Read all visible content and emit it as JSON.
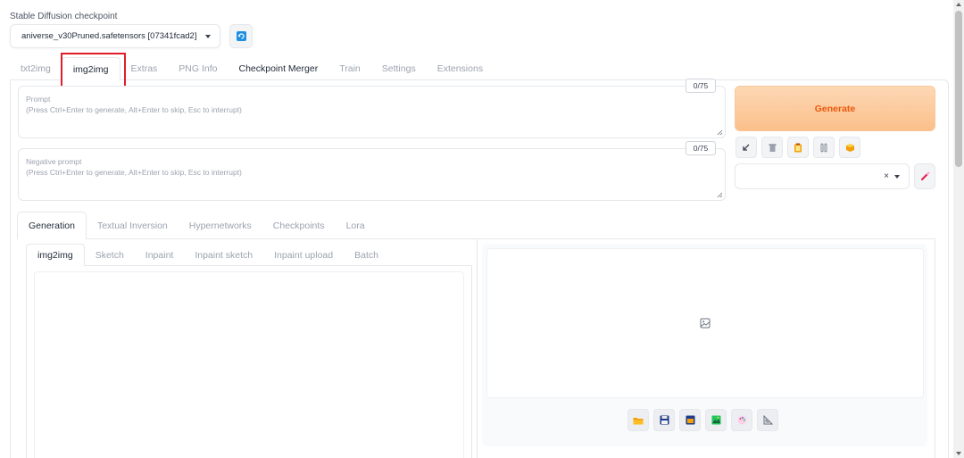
{
  "checkpoint": {
    "label": "Stable Diffusion checkpoint",
    "selected": "aniverse_v30Pruned.safetensors [07341fcad2]"
  },
  "top_tabs": [
    {
      "label": "txt2img"
    },
    {
      "label": "img2img"
    },
    {
      "label": "Extras"
    },
    {
      "label": "PNG Info"
    },
    {
      "label": "Checkpoint Merger"
    },
    {
      "label": "Train"
    },
    {
      "label": "Settings"
    },
    {
      "label": "Extensions"
    }
  ],
  "prompt": {
    "label": "Prompt",
    "placeholder": "(Press Ctrl+Enter to generate, Alt+Enter to skip, Esc to interrupt)",
    "token_count": "0/75"
  },
  "negative_prompt": {
    "label": "Negative prompt",
    "placeholder": "(Press Ctrl+Enter to generate, Alt+Enter to skip, Esc to interrupt)",
    "token_count": "0/75"
  },
  "generate": {
    "label": "Generate"
  },
  "style_select": {
    "clear_symbol": "×"
  },
  "sub_tabs": [
    {
      "label": "Generation"
    },
    {
      "label": "Textual Inversion"
    },
    {
      "label": "Hypernetworks"
    },
    {
      "label": "Checkpoints"
    },
    {
      "label": "Lora"
    }
  ],
  "img_tabs": [
    {
      "label": "img2img"
    },
    {
      "label": "Sketch"
    },
    {
      "label": "Inpaint"
    },
    {
      "label": "Inpaint sketch"
    },
    {
      "label": "Inpaint upload"
    },
    {
      "label": "Batch"
    }
  ],
  "colors": {
    "accent": "#ea580c",
    "highlight": "#e11d2a"
  }
}
